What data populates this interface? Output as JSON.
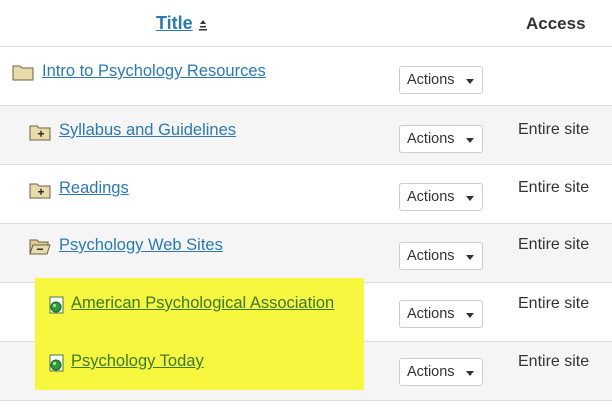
{
  "header": {
    "title_label": "Title",
    "access_label": "Access"
  },
  "rows": [
    {
      "label": "Intro to Psychology Resources",
      "icon": "folder-icon",
      "actions": "Actions",
      "access": ""
    },
    {
      "label": "Syllabus and Guidelines",
      "icon": "folder-plus-icon",
      "actions": "Actions",
      "access": "Entire site"
    },
    {
      "label": "Readings",
      "icon": "folder-plus-icon",
      "actions": "Actions",
      "access": "Entire site"
    },
    {
      "label": "Psychology Web Sites",
      "icon": "folder-open-icon",
      "actions": "Actions",
      "access": "Entire site"
    },
    {
      "label": "American Psychological Association",
      "icon": "web-link-icon",
      "actions": "Actions",
      "access": "Entire site"
    },
    {
      "label": "Psychology Today",
      "icon": "web-link-icon",
      "actions": "Actions",
      "access": "Entire site"
    }
  ],
  "colors": {
    "link": "#2a7ab0",
    "highlight": "#f7f740",
    "highlighted_link": "#3c7a2c"
  }
}
